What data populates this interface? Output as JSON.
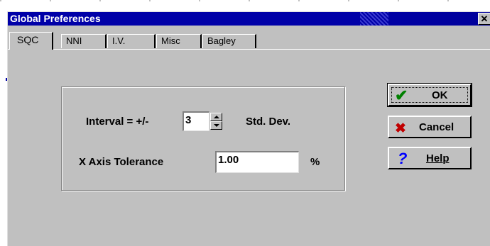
{
  "window": {
    "title": "Global Preferences",
    "close_glyph": "✕"
  },
  "tabs": [
    {
      "label": "SQC",
      "active": true
    },
    {
      "label": "NNI",
      "active": false
    },
    {
      "label": "I.V.",
      "active": false
    },
    {
      "label": "Misc",
      "active": false
    },
    {
      "label": "Bagley",
      "active": false
    }
  ],
  "sqc": {
    "interval_label": "Interval = +/-",
    "interval_value": "3",
    "interval_unit": "Std. Dev.",
    "tolerance_label": "X Axis Tolerance",
    "tolerance_value": "1.00",
    "tolerance_unit": "%"
  },
  "buttons": {
    "ok": {
      "label": "OK",
      "icon": "checkmark-icon",
      "glyph": "✔",
      "color": "#008000"
    },
    "cancel": {
      "label": "Cancel",
      "icon": "x-icon",
      "glyph": "✖",
      "color": "#c00000"
    },
    "help": {
      "label": "Help",
      "icon": "question-icon",
      "glyph": "?",
      "color": "#0000ff"
    }
  },
  "colors": {
    "titlebar": "#0000a8",
    "face": "#c0c0c0"
  }
}
